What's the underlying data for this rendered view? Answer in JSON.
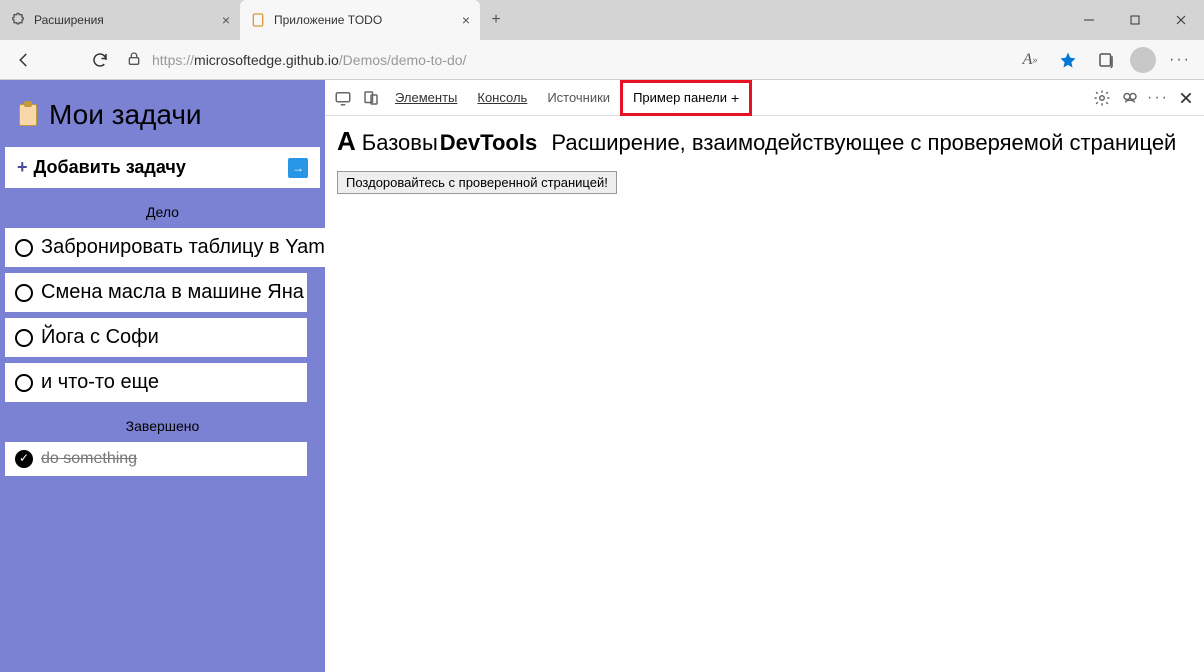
{
  "window": {
    "tabs": [
      {
        "title": "Расширения",
        "active": false
      },
      {
        "title": "Приложение TODO",
        "active": true
      }
    ]
  },
  "addressbar": {
    "url_prefix": "https://",
    "url_host": "microsoftedge.github.io",
    "url_path": "/Demos/demo-to-do/"
  },
  "todo": {
    "title": "Мои задачи",
    "add_label": "Добавить задачу",
    "sections": {
      "todo_label": "Дело",
      "done_label": "Завершено"
    },
    "tasks": [
      "Забронировать таблицу в Yam Yam",
      "Смена масла в машине Яна",
      "Йога с Софи",
      "и что-то еще"
    ],
    "done_tasks": [
      "do something"
    ]
  },
  "devtools": {
    "tabs": {
      "elements": "Элементы",
      "console": "Консоль",
      "sources": "Источники",
      "custom": "Пример панели",
      "plus": "+"
    },
    "heading_A": "A",
    "heading_pre": "Базовы",
    "heading_devtools": "DevTools",
    "heading_post": "Расширение, взаимодействующее с проверяемой страницей",
    "button": "Поздоровайтесь с проверенной страницей!"
  }
}
